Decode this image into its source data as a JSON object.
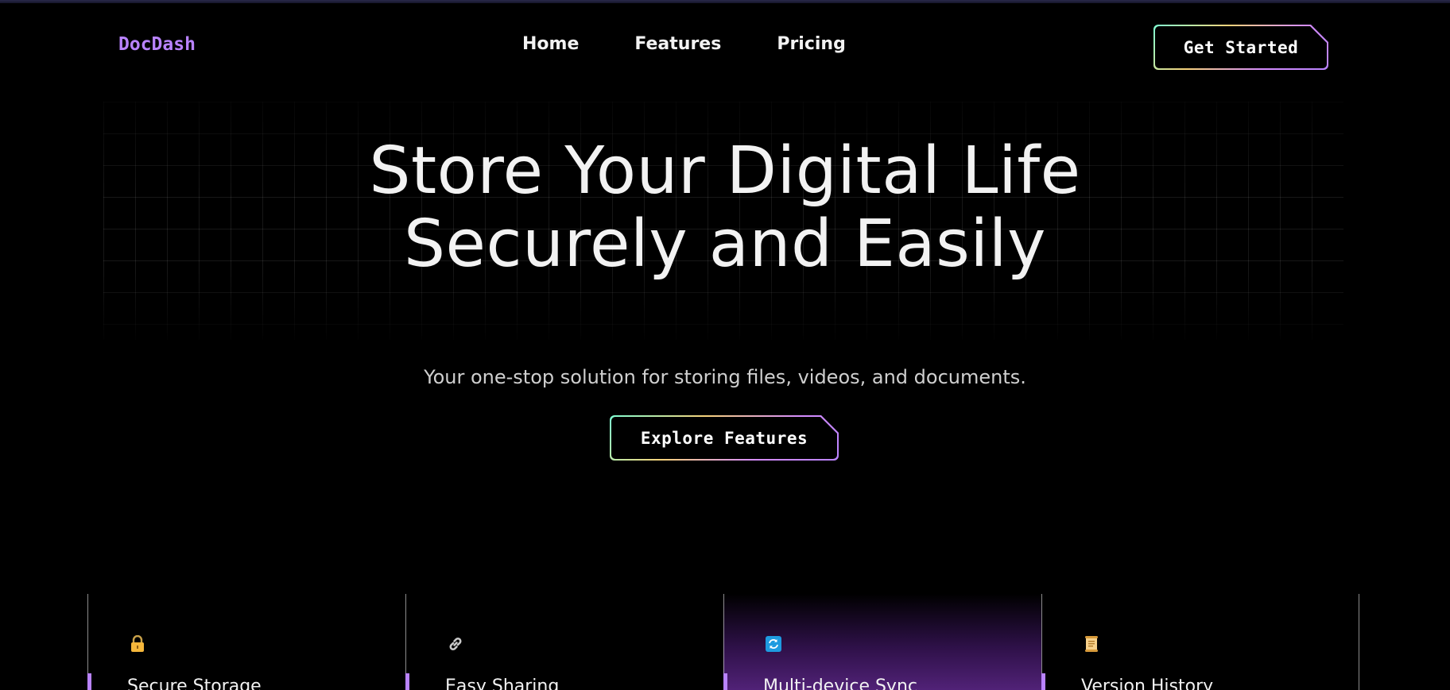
{
  "brand": {
    "name": "DocDash",
    "color": "#b983ff"
  },
  "nav": {
    "items": [
      {
        "label": "Home"
      },
      {
        "label": "Features"
      },
      {
        "label": "Pricing"
      }
    ]
  },
  "header": {
    "cta_label": "Get Started"
  },
  "hero": {
    "title_line1": "Store Your Digital Life",
    "title_line2": "Securely and Easily",
    "subtitle": "Your one-stop solution for storing files, videos, and documents.",
    "cta_label": "Explore Features"
  },
  "features": [
    {
      "title": "Secure Storage",
      "icon": "lock-icon",
      "active": false
    },
    {
      "title": "Easy Sharing",
      "icon": "link-icon",
      "active": false
    },
    {
      "title": "Multi-device Sync",
      "icon": "sync-icon",
      "active": true
    },
    {
      "title": "Version History",
      "icon": "scroll-icon",
      "active": false
    }
  ],
  "colors": {
    "background": "#000000",
    "accent": "#b983ff",
    "button_gradient": [
      "#7fffd4",
      "#f6d27a",
      "#d58cff",
      "#b983ff"
    ]
  }
}
